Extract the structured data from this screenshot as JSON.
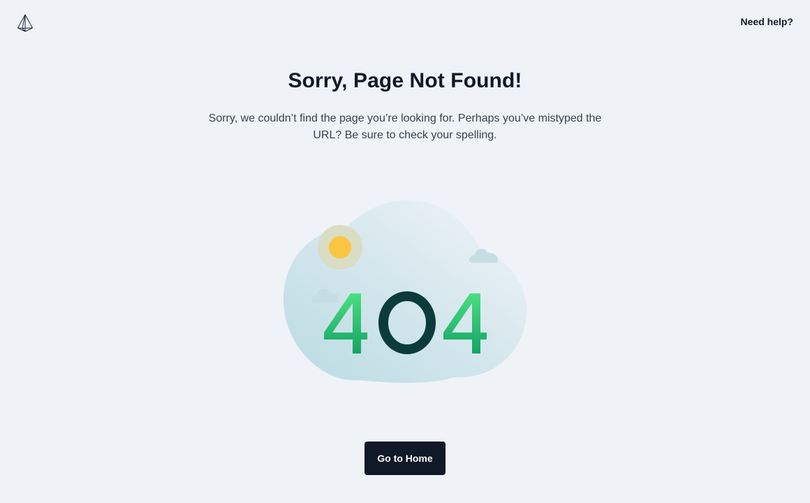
{
  "header": {
    "logo_icon": "prism-logo-icon",
    "help_label": "Need help?"
  },
  "main": {
    "title": "Sorry, Page Not Found!",
    "message": "Sorry, we couldn’t find the page you’re looking for. Perhaps you’ve mistyped the URL? Be sure to check your spelling.",
    "illustration": {
      "code": "404",
      "icons": [
        "sun-icon",
        "cloud-icon",
        "cloud-icon"
      ]
    },
    "button_label": "Go to Home"
  },
  "colors": {
    "background": "#eff3f7",
    "text_primary": "#111827",
    "text_secondary": "#374151",
    "button_bg": "#111827",
    "button_text": "#ffffff",
    "digit_green": "#22c55e",
    "digit_dark": "#0b3b3b",
    "sun": "#fcc541",
    "blob": "#c6e0e6"
  }
}
